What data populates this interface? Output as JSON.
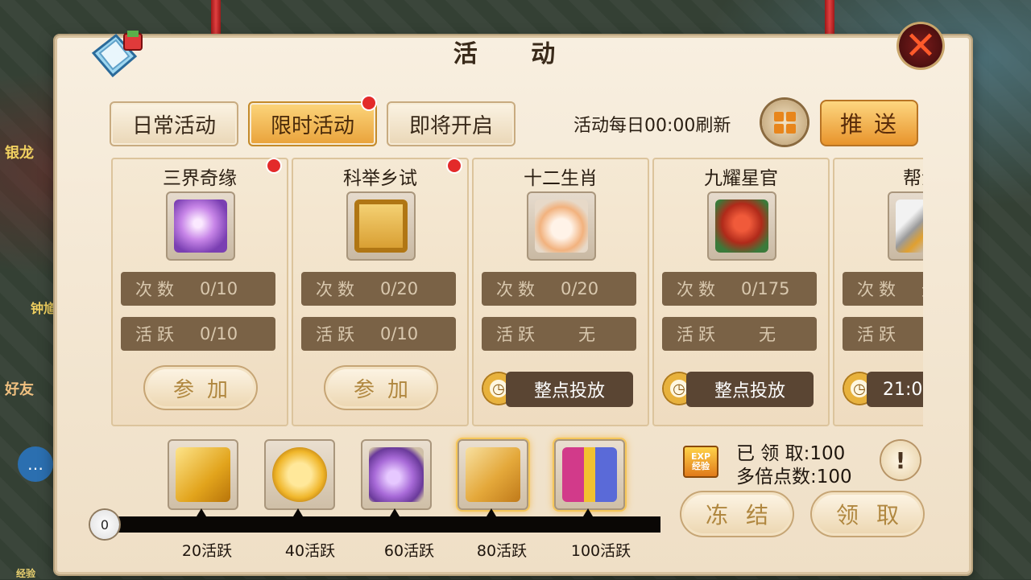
{
  "window": {
    "title": "活 动"
  },
  "tabs": [
    {
      "label": "日常活动",
      "active": false,
      "badge": false
    },
    {
      "label": "限时活动",
      "active": true,
      "badge": true
    },
    {
      "label": "即将开启",
      "active": false,
      "badge": false
    }
  ],
  "header": {
    "refresh_text": "活动每日00:00刷新",
    "push_label": "推送"
  },
  "background": {
    "side_text_1": "银龙",
    "side_text_2": "钟馗",
    "side_text_3": "好友",
    "bottom_left": "经验"
  },
  "activities": [
    {
      "name": "三界奇缘",
      "count_key": "次数",
      "count_val": "0/10",
      "active_key": "活跃",
      "active_val": "0/10",
      "action": "参加",
      "action_type": "join",
      "badge": true,
      "icon": "spirit-gem-icon"
    },
    {
      "name": "科举乡试",
      "count_key": "次数",
      "count_val": "0/20",
      "active_key": "活跃",
      "active_val": "0/10",
      "action": "参加",
      "action_type": "join",
      "badge": true,
      "icon": "scroll-icon"
    },
    {
      "name": "十二生肖",
      "count_key": "次数",
      "count_val": "0/20",
      "active_key": "活跃",
      "active_val": "无",
      "action": "整点投放",
      "action_type": "timed",
      "badge": false,
      "icon": "zodiac-pet-icon"
    },
    {
      "name": "九耀星官",
      "count_key": "次数",
      "count_val": "0/175",
      "active_key": "活跃",
      "active_val": "无",
      "action": "整点投放",
      "action_type": "timed",
      "badge": false,
      "icon": "star-mask-icon"
    },
    {
      "name": "帮派",
      "count_key": "次数",
      "count_val": "无",
      "active_key": "活跃",
      "active_val": "",
      "action": "21:0",
      "action_type": "timed",
      "badge": false,
      "icon": "sword-icon"
    }
  ],
  "rewards": [
    {
      "threshold": "20活跃",
      "icon": "vip-card-icon"
    },
    {
      "threshold": "40活跃",
      "icon": "gold-coin-icon"
    },
    {
      "threshold": "60活跃",
      "icon": "treasure-bag-icon"
    },
    {
      "threshold": "80活跃",
      "icon": "scroll-map-icon"
    },
    {
      "threshold": "100活跃",
      "icon": "gift-box-icon"
    }
  ],
  "progress": {
    "start_label": "0",
    "value": 0,
    "max": 100
  },
  "summary": {
    "exp_icon_text": "EXP",
    "exp_icon_sub": "经验",
    "claimed_label": "已 领 取:",
    "claimed_value": "100",
    "multi_label": "多倍点数:",
    "multi_value": "100",
    "freeze_label": "冻结",
    "claim_label": "领取",
    "help_glyph": "!"
  },
  "colors": {
    "accent": "#e8942c",
    "badge": "#e32a2a",
    "stat_bg": "#7a6246"
  }
}
